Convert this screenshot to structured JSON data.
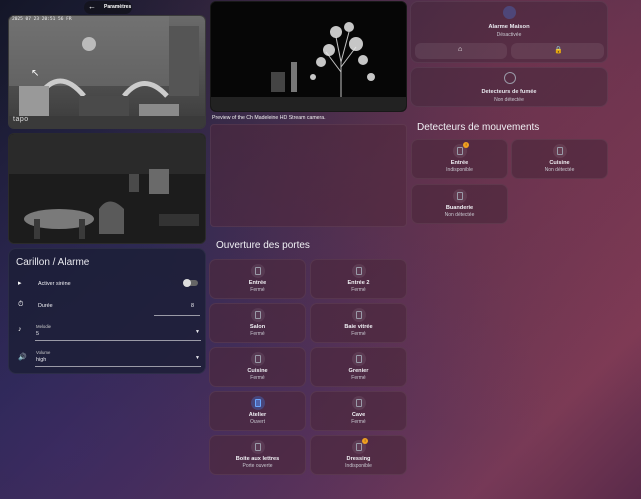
{
  "header": {
    "back_icon": "arrow-left-icon",
    "title": "Paramètres"
  },
  "cameras": {
    "cam1_timestamp": "2025 07 23 20:51 56 FR",
    "cam1_logo": "tapo",
    "preview_caption": "Preview of the Ch Madeleine HD Stream camera."
  },
  "alarm": {
    "name": "Alarme Maison",
    "state": "Désactivée",
    "home_icon": "home-icon",
    "lock_icon": "lock-icon"
  },
  "smoke": {
    "name": "Detecteurs de fumée",
    "state": "Non détectée"
  },
  "motion": {
    "title": "Detecteurs de mouvements",
    "items": [
      {
        "name": "Entrée",
        "state": "Indisponible",
        "badge": "!"
      },
      {
        "name": "Cuisine",
        "state": "Non détectée"
      },
      {
        "name": "Buanderie",
        "state": "Non détectée"
      }
    ]
  },
  "doors": {
    "title": "Ouverture des portes",
    "items": [
      {
        "name": "Entrée",
        "state": "Fermé"
      },
      {
        "name": "Entrée 2",
        "state": "Fermé"
      },
      {
        "name": "Salon",
        "state": "Fermé"
      },
      {
        "name": "Baie vitrée",
        "state": "Fermé"
      },
      {
        "name": "Cuisine",
        "state": "Fermé"
      },
      {
        "name": "Grenier",
        "state": "Fermé"
      },
      {
        "name": "Atelier",
        "state": "Ouvert"
      },
      {
        "name": "Cave",
        "state": "Fermé"
      },
      {
        "name": "Boite aux lettres",
        "state": "Porte ouverte"
      },
      {
        "name": "Dressing",
        "state": "Indisponible",
        "badge": "!"
      }
    ]
  },
  "chime": {
    "title": "Carillon / Alarme",
    "siren_label": "Activer sirène",
    "duration_label": "Durée",
    "duration_value": "8",
    "melody_label": "Melodie",
    "melody_value": "5",
    "volume_label": "Volume",
    "volume_value": "high"
  }
}
